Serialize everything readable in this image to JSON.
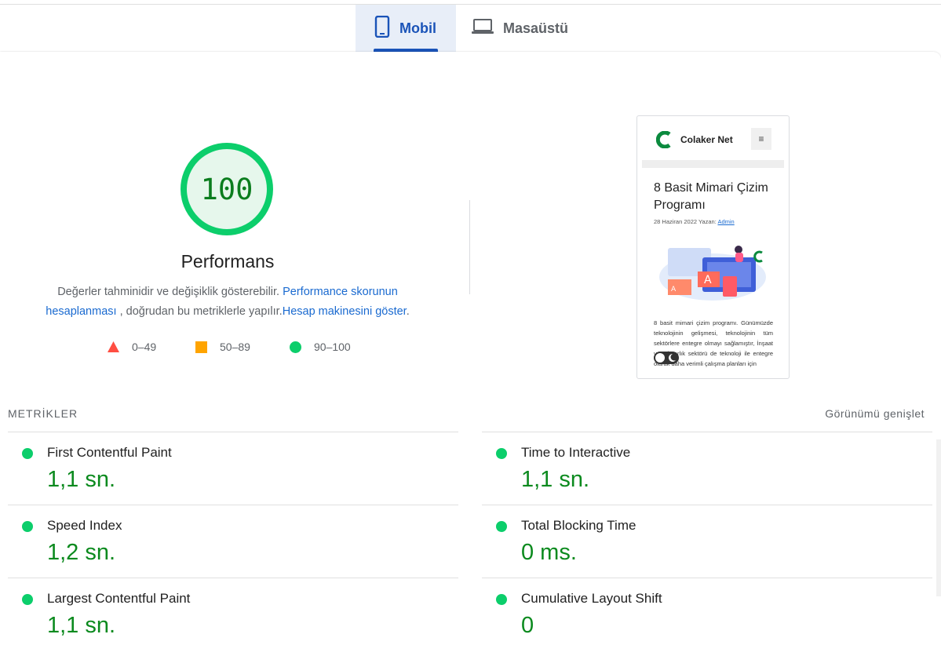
{
  "tabs": [
    {
      "label": "Mobil",
      "icon": "mobile-phone-icon",
      "active": true
    },
    {
      "label": "Masaüstü",
      "icon": "laptop-icon",
      "active": false
    }
  ],
  "score": {
    "value": "100",
    "title": "Performans",
    "color": "#0cce6b"
  },
  "description": {
    "text1": "Değerler tahminidir ve değişiklik gösterebilir.",
    "link1": "Performance skorunun hesaplanması",
    "text2": ", doğrudan bu metriklerle yapılır.",
    "link2": "Hesap makinesini göster",
    "text3": "."
  },
  "legend": [
    {
      "label": "0–49",
      "shape": "triangle",
      "color": "#ff4e42"
    },
    {
      "label": "50–89",
      "shape": "square",
      "color": "#ffa400"
    },
    {
      "label": "90–100",
      "shape": "circle",
      "color": "#0cce6b"
    }
  ],
  "screenshot": {
    "site_name": "Colaker Net",
    "menu_glyph": "≡",
    "title": "8 Basit Mimari Çizim Programı",
    "meta_prefix": "28 Haziran 2022 Yazan:",
    "author": "Admin",
    "body": "8 basit mimari çizim programı. Günümüzde teknolojinin gelişmesi, teknolojinin tüm sektörlere entegre olmayı sağlamıştır, İnşaat ve mimarlık sektörü de teknoloji ile entegre olarak daha verimli çalışma planları için"
  },
  "metrics_section": {
    "label": "METRİKLER",
    "expand": "Görünümü genişlet"
  },
  "metrics": {
    "left": [
      {
        "name": "First Contentful Paint",
        "value": "1,1 sn."
      },
      {
        "name": "Speed Index",
        "value": "1,2 sn."
      },
      {
        "name": "Largest Contentful Paint",
        "value": "1,1 sn."
      }
    ],
    "right": [
      {
        "name": "Time to Interactive",
        "value": "1,1 sn."
      },
      {
        "name": "Total Blocking Time",
        "value": "0 ms."
      },
      {
        "name": "Cumulative Layout Shift",
        "value": "0"
      }
    ]
  }
}
